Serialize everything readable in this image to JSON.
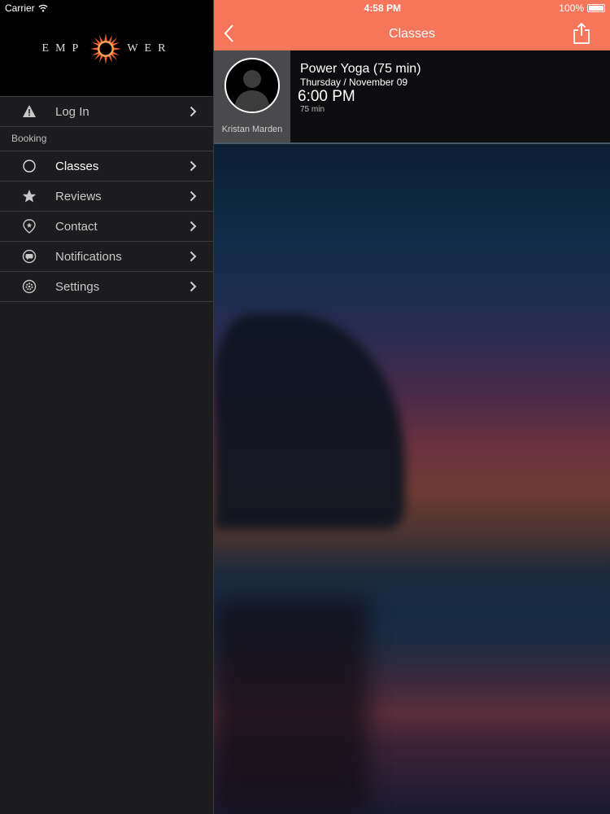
{
  "status_bar": {
    "carrier": "Carrier",
    "time": "4:58 PM",
    "battery": "100%"
  },
  "brand": {
    "left": "EMP",
    "right": "WER"
  },
  "sidebar": {
    "login_label": "Log In",
    "section_label": "Booking",
    "items": [
      {
        "label": "Classes",
        "icon": "circle-icon"
      },
      {
        "label": "Reviews",
        "icon": "star-icon"
      },
      {
        "label": "Contact",
        "icon": "location-pin-icon"
      },
      {
        "label": "Notifications",
        "icon": "chat-bubble-icon"
      },
      {
        "label": "Settings",
        "icon": "gear-icon"
      }
    ]
  },
  "nav": {
    "title": "Classes"
  },
  "class_card": {
    "instructor": "Kristan Marden",
    "title": "Power Yoga (75 min)",
    "date": "Thursday / November 09",
    "time": "6:00 PM",
    "duration": "75 min"
  },
  "colors": {
    "accent": "#f5765a",
    "sidebar_bg": "#1c1c1e",
    "card_bg": "#0d0d0f"
  }
}
